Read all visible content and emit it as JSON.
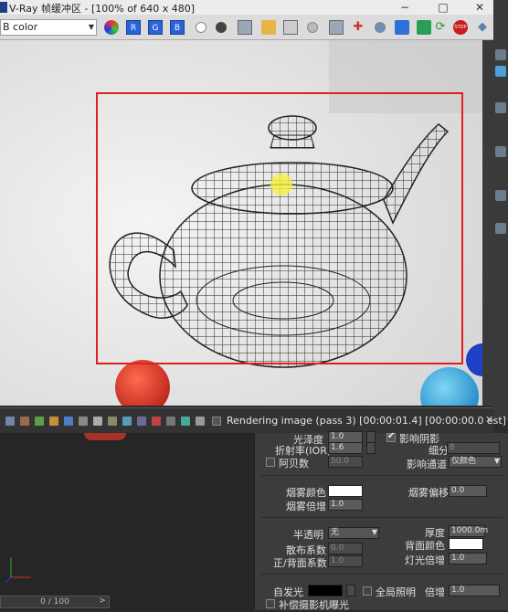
{
  "window": {
    "title": "V-Ray 帧缓冲区 - [100% of 640 x 480]",
    "minimize": "−",
    "maximize": "□",
    "close": "✕"
  },
  "toolbar": {
    "channel": "RGB color",
    "channel_visible": "B color",
    "rgb_buttons": [
      "R",
      "G",
      "B"
    ],
    "stop_label": "STOP"
  },
  "status": {
    "render_text": "Rendering image (pass 3) [00:00:01.4] [00:00:00.0 est]",
    "close": "✕"
  },
  "timeline": {
    "frame": "0 / 100",
    "next": ">"
  },
  "panel": {
    "glossiness": {
      "label": "光泽度",
      "value": "1.0"
    },
    "ior": {
      "label": "折射率(IOR)",
      "value": "1.6"
    },
    "abbe": {
      "label": "阿贝数",
      "value": "50.0"
    },
    "affect_shadows": {
      "label": "影响阴影"
    },
    "subdivs": {
      "label": "细分",
      "value": "8"
    },
    "affect_channels": {
      "label": "影响通道",
      "value": "仅颜色"
    },
    "fog_color": {
      "label": "烟雾颜色",
      "color": "#ffffff"
    },
    "fog_bias": {
      "label": "烟雾偏移",
      "value": "0.0"
    },
    "fog_multiplier": {
      "label": "烟雾倍增",
      "value": "1.0"
    },
    "translucency": {
      "label": "半透明",
      "value": "无"
    },
    "scatter_coeff": {
      "label": "散布系数",
      "value": "0.0"
    },
    "fwd_bck_coeff": {
      "label": "正/背面系数",
      "value": "1.0"
    },
    "thickness": {
      "label": "厚度",
      "value": "1000.0m"
    },
    "back_color": {
      "label": "背面颜色",
      "color": "#ffffff"
    },
    "light_multiplier": {
      "label": "灯光倍增",
      "value": "1.0"
    },
    "self_illum": {
      "label": "自发光",
      "color": "#000000"
    },
    "gi": {
      "label": "全局照明"
    },
    "self_illum_mult": {
      "label": "倍增",
      "value": "1.0"
    },
    "compensate_exposure": {
      "label": "补偿摄影机曝光"
    }
  },
  "colors": {
    "region_box": "#e02020",
    "red_sphere": "#d93a2a",
    "blue_sphere": "#2ea6d8",
    "dark_blue_sphere": "#1f3fc4"
  }
}
